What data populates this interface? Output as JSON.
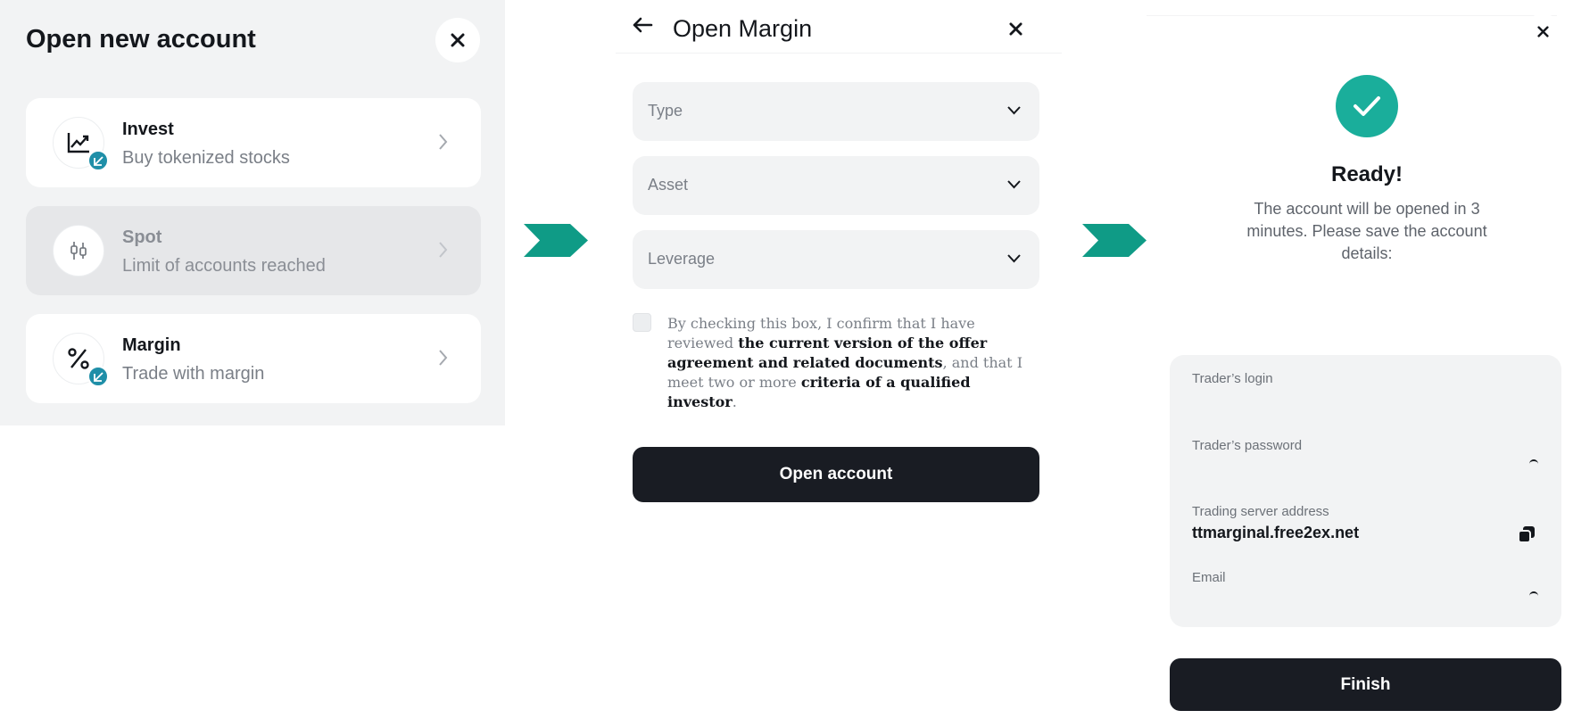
{
  "panel1": {
    "title": "Open new account",
    "accounts": [
      {
        "name": "Invest",
        "description": "Buy tokenized stocks",
        "icon": "chart-up-icon",
        "badge": "fx-badge-icon",
        "disabled": false
      },
      {
        "name": "Spot",
        "description": "Limit of accounts reached",
        "icon": "candlestick-icon",
        "disabled": true
      },
      {
        "name": "Margin",
        "description": "Trade with margin",
        "icon": "percent-icon",
        "badge": "fx-badge-icon",
        "disabled": false
      }
    ]
  },
  "panel2": {
    "title": "Open Margin",
    "fields": [
      {
        "placeholder": "Type"
      },
      {
        "placeholder": "Asset"
      },
      {
        "placeholder": "Leverage"
      }
    ],
    "consent": {
      "part1": "By checking this box, I confirm that I have reviewed ",
      "link1": "the current version of the offer agreement and related documents",
      "part2": ", and that I meet two or more ",
      "link2": "criteria of a qualified investor",
      "part3": "."
    },
    "submit_label": "Open account"
  },
  "panel3": {
    "title": "Ready!",
    "description": "The account will be opened in 3 minutes. Please save the account details:",
    "details": {
      "login_label": "Trader’s login",
      "password_label": "Trader’s password",
      "server_label": "Trading server address",
      "server_value": "ttmarginal.free2ex.net",
      "email_label": "Email"
    },
    "finish_label": "Finish"
  },
  "colors": {
    "accent": "#1aae9b",
    "arrow": "#0f9b86",
    "badge": "#1f8fa8",
    "button": "#191c23",
    "panel_bg": "#f2f3f4"
  }
}
